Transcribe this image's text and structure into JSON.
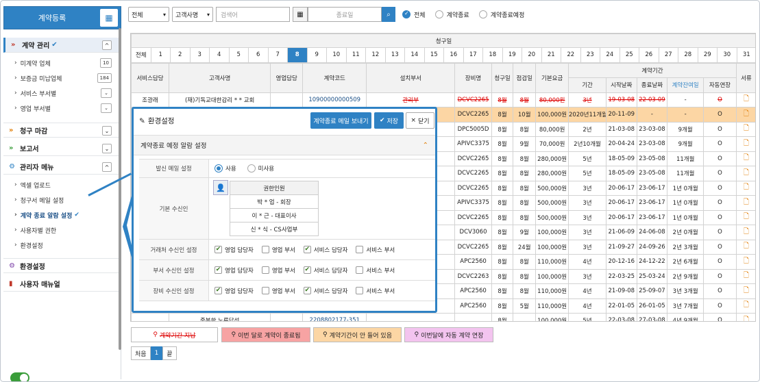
{
  "sidebar": {
    "register_label": "계약등록",
    "sections": [
      {
        "label": "계약 관리",
        "toggle": "^",
        "items": [
          {
            "label": "미계약 업체",
            "badge": "10"
          },
          {
            "label": "보증금 미납업체",
            "badge": "184"
          },
          {
            "label": "서비스 부서별",
            "badge": "⌄"
          },
          {
            "label": "영업 부서별",
            "badge": "⌄"
          }
        ]
      },
      {
        "label": "청구 마감",
        "toggle": "⌄"
      },
      {
        "label": "보고서",
        "toggle": "⌄"
      },
      {
        "label": "관리자 메뉴",
        "toggle": "^",
        "items": [
          {
            "label": "엑셀 업로드"
          },
          {
            "label": "청구서 메일 설정"
          },
          {
            "label": "계약 종료 알람 설정"
          },
          {
            "label": "사용자별 권한"
          },
          {
            "label": "환경설정"
          }
        ]
      },
      {
        "label": "환경설정"
      },
      {
        "label": "사용자 매뉴얼"
      }
    ]
  },
  "toolbar": {
    "filter1": "전체",
    "filter2": "고객사명",
    "search_placeholder": "검색어",
    "end_date_placeholder": "종료일",
    "radios": [
      "전체",
      "계약종료",
      "계약종료예정"
    ]
  },
  "table": {
    "billing_day_title": "청구일",
    "days_all": "전체",
    "days": [
      "1",
      "2",
      "3",
      "4",
      "5",
      "6",
      "7",
      "8",
      "9",
      "10",
      "11",
      "12",
      "13",
      "14",
      "15",
      "16",
      "17",
      "18",
      "19",
      "20",
      "21",
      "22",
      "23",
      "24",
      "25",
      "26",
      "27",
      "28",
      "29",
      "30",
      "31"
    ],
    "selected_day": "8",
    "headers": [
      "서비스담당",
      "고객사명",
      "영업담당",
      "계약코드",
      "설치부서",
      "장비명",
      "청구일",
      "점검일",
      "기본요금",
      "계약기간",
      "서류"
    ],
    "period_headers": [
      "기간",
      "시작날짜",
      "종료날짜",
      "계약잔여일",
      "자동연장"
    ],
    "rows": [
      {
        "svc": "조광래",
        "cust": "(재)기독교대한감리 * * 교회",
        "sales": "",
        "code": "10900000000509",
        "dept": "관리부",
        "equip": "DCVC2265",
        "bill": "8월",
        "check": "8월",
        "fee": "80,000원",
        "period": "3년",
        "start": "19-03-08",
        "end": "22-03-09",
        "remain": "-",
        "auto": "O",
        "strike": true
      },
      {
        "svc": "",
        "cust": "",
        "sales": "",
        "code": "",
        "dept": "",
        "equip": "DCVC2265",
        "bill": "8월",
        "check": "10월",
        "fee": "100,000원",
        "period": "2020년11개월",
        "start": "20-11-09",
        "end": "-",
        "remain": "-",
        "auto": "O",
        "hl": true
      },
      {
        "equip": "DPC5005D",
        "bill": "8월",
        "check": "8월",
        "fee": "80,000원",
        "period": "2년",
        "start": "21-03-08",
        "end": "23-03-08",
        "remain": "9개월",
        "auto": "O"
      },
      {
        "equip": "APIVC3375",
        "bill": "8월",
        "check": "9월",
        "fee": "70,000원",
        "period": "2년10개월",
        "start": "20-04-24",
        "end": "23-03-08",
        "remain": "9개월",
        "auto": "O"
      },
      {
        "equip": "DCVC2265",
        "bill": "8월",
        "check": "8월",
        "fee": "280,000원",
        "period": "5년",
        "start": "18-05-09",
        "end": "23-05-08",
        "remain": "11개월",
        "auto": "O"
      },
      {
        "equip": "DCVC2265",
        "bill": "8월",
        "check": "8월",
        "fee": "280,000원",
        "period": "5년",
        "start": "18-05-09",
        "end": "23-05-08",
        "remain": "11개월",
        "auto": "O"
      },
      {
        "equip": "DCVC2265",
        "bill": "8월",
        "check": "8월",
        "fee": "500,000원",
        "period": "3년",
        "start": "20-06-17",
        "end": "23-06-17",
        "remain": "1년 0개월",
        "auto": "O"
      },
      {
        "equip": "APIVC3375",
        "bill": "8월",
        "check": "8월",
        "fee": "500,000원",
        "period": "3년",
        "start": "20-06-17",
        "end": "23-06-17",
        "remain": "1년 0개월",
        "auto": "O"
      },
      {
        "equip": "DCVC2265",
        "bill": "8월",
        "check": "8월",
        "fee": "500,000원",
        "period": "3년",
        "start": "20-06-17",
        "end": "23-06-17",
        "remain": "1년 0개월",
        "auto": "O"
      },
      {
        "equip": "DCV3060",
        "bill": "8월",
        "check": "9월",
        "fee": "100,000원",
        "period": "3년",
        "start": "21-06-09",
        "end": "24-06-08",
        "remain": "2년 0개월",
        "auto": "O"
      },
      {
        "equip": "DCVC2265",
        "bill": "8월",
        "check": "24월",
        "fee": "100,000원",
        "period": "3년",
        "start": "21-09-27",
        "end": "24-09-26",
        "remain": "2년 3개월",
        "auto": "O"
      },
      {
        "equip": "APC2560",
        "bill": "8월",
        "check": "8월",
        "fee": "110,000원",
        "period": "4년",
        "start": "20-12-16",
        "end": "24-12-22",
        "remain": "2년 6개월",
        "auto": "O"
      },
      {
        "equip": "DCVC2263",
        "bill": "8월",
        "check": "8월",
        "fee": "100,000원",
        "period": "3년",
        "start": "22-03-25",
        "end": "25-03-24",
        "remain": "2년 9개월",
        "auto": "O"
      },
      {
        "equip": "APC2560",
        "bill": "8월",
        "check": "8월",
        "fee": "110,000원",
        "period": "4년",
        "start": "21-09-08",
        "end": "25-09-07",
        "remain": "3년 3개월",
        "auto": "O"
      },
      {
        "equip": "APC2560",
        "bill": "8월",
        "check": "5월",
        "fee": "110,000원",
        "period": "4년",
        "start": "22-01-05",
        "end": "26-01-05",
        "remain": "3년 7개월",
        "auto": "O"
      },
      {
        "svc": "",
        "cust": "중복한 노루답선",
        "sales": "",
        "code": "2208802177-351",
        "dept": "",
        "equip": "",
        "bill": "8월",
        "check": "",
        "fee": "100,000원",
        "period": "5년",
        "start": "22-03-08",
        "end": "27-03-08",
        "remain": "4년 9개월",
        "auto": "O"
      }
    ]
  },
  "legend": [
    {
      "label": "계약기간 지남",
      "bg": "#ffffff",
      "strike": true
    },
    {
      "label": "이번 달로 계약이 종료됨",
      "bg": "#f7a3a3"
    },
    {
      "label": "계약기간이 안 들어 있음",
      "bg": "#fcd6a4"
    },
    {
      "label": "이번달에 자동 계약 연장",
      "bg": "#f3c4ef"
    }
  ],
  "pager": {
    "first": "처음",
    "current": "1",
    "last": "끝"
  },
  "popup": {
    "title": "환경설정",
    "send_mail_btn": "계약종료 메일 보내기",
    "save_btn": "저장",
    "close_btn": "닫기",
    "section_title": "계약종료 예정 알람 설정",
    "sender_label": "발신 메일 설정",
    "sender_opt_on": "사용",
    "sender_opt_off": "미사용",
    "recipients_label": "기본 수신인",
    "recipients_header": "권한인원",
    "recipients": [
      "박 * 업 - 회장",
      "이 * 근 - 대표이사",
      "신 * 식 - CS사업부"
    ],
    "rows": [
      {
        "label": "거래처 수신인 설정",
        "opts": [
          {
            "t": "영업 담당자",
            "c": true
          },
          {
            "t": "영업 부서",
            "c": false
          },
          {
            "t": "서비스 담당자",
            "c": true
          },
          {
            "t": "서비스 부서",
            "c": false
          }
        ]
      },
      {
        "label": "부서 수신인 설정",
        "opts": [
          {
            "t": "영업 담당자",
            "c": true
          },
          {
            "t": "영업 부서",
            "c": false
          },
          {
            "t": "서비스 담당자",
            "c": true
          },
          {
            "t": "서비스 부서",
            "c": false
          }
        ]
      },
      {
        "label": "장비 수신인 설정",
        "opts": [
          {
            "t": "영업 담당자",
            "c": true
          },
          {
            "t": "영업 부서",
            "c": false
          },
          {
            "t": "서비스 담당자",
            "c": true
          },
          {
            "t": "서비스 부서",
            "c": false
          }
        ]
      }
    ]
  }
}
